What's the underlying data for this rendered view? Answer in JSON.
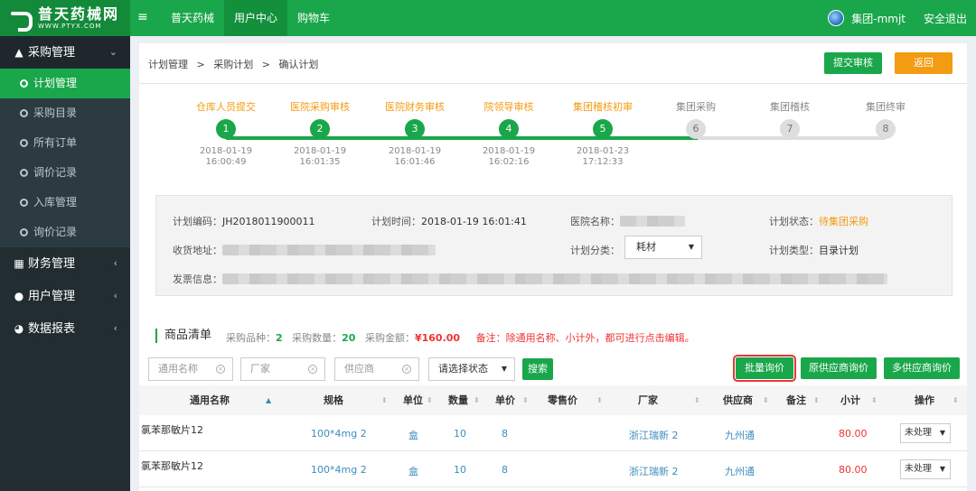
{
  "brand": {
    "name_cn": "普天药械网",
    "name_en": "WWW.PTYX.COM"
  },
  "topnav": [
    {
      "label": "普天药械"
    },
    {
      "label": "用户中心"
    },
    {
      "label": "购物车"
    }
  ],
  "user": {
    "name": "集团-mmjt",
    "logout": "安全退出"
  },
  "sidebar": {
    "groups": [
      {
        "label": "采购管理",
        "icon": "cart-icon"
      },
      {
        "label": "财务管理",
        "icon": "finance-icon"
      },
      {
        "label": "用户管理",
        "icon": "user-icon"
      },
      {
        "label": "数据报表",
        "icon": "chart-icon"
      }
    ],
    "sub_items": [
      {
        "label": "计划管理"
      },
      {
        "label": "采购目录"
      },
      {
        "label": "所有订单"
      },
      {
        "label": "调价记录"
      },
      {
        "label": "入库管理"
      },
      {
        "label": "询价记录"
      }
    ]
  },
  "breadcrumb": {
    "a": "计划管理",
    "sep": ">",
    "b": "采购计划",
    "c": "确认计划"
  },
  "actions": {
    "submit": "提交审核",
    "back": "返回"
  },
  "steps": [
    {
      "num": "1",
      "label": "仓库人员提交",
      "date": "2018-01-19",
      "time": "16:00:49",
      "done": true
    },
    {
      "num": "2",
      "label": "医院采购审核",
      "date": "2018-01-19",
      "time": "16:01:35",
      "done": true
    },
    {
      "num": "3",
      "label": "医院财务审核",
      "date": "2018-01-19",
      "time": "16:01:46",
      "done": true
    },
    {
      "num": "4",
      "label": "院领导审核",
      "date": "2018-01-19",
      "time": "16:02:16",
      "done": true
    },
    {
      "num": "5",
      "label": "集团稽核初审",
      "date": "2018-01-23",
      "time": "17:12:33",
      "done": true
    },
    {
      "num": "6",
      "label": "集团采购",
      "date": "",
      "time": "",
      "done": false
    },
    {
      "num": "7",
      "label": "集团稽核",
      "date": "",
      "time": "",
      "done": false
    },
    {
      "num": "8",
      "label": "集团终审",
      "date": "",
      "time": "",
      "done": false
    }
  ],
  "plan": {
    "code_label": "计划编码：",
    "code": "JH2018011900011",
    "time_label": "计划时间：",
    "time": "2018-01-19 16:01:41",
    "hospital_label": "医院名称：",
    "status_label": "计划状态：",
    "status": "待集团采购",
    "address_label": "收货地址：",
    "category_label": "计划分类：",
    "category": "耗材",
    "type_label": "计划类型：",
    "type": "目录计划",
    "invoice_label": "发票信息："
  },
  "goods": {
    "title": "商品清单",
    "kinds_label": "采购品种：",
    "kinds": "2",
    "qty_label": "采购数量：",
    "qty": "20",
    "amount_label": "采购金额：",
    "amount": "¥160.00",
    "note": "备注：除通用名称、小计外，都可进行点击编辑。"
  },
  "filters": {
    "name_placeholder": "通用名称",
    "maker_placeholder": "厂家",
    "supplier_placeholder": "供应商",
    "status_select": "请选择状态",
    "search": "搜索",
    "batch_inquiry": "批量询价",
    "orig_inquiry": "原供应商询价",
    "multi_inquiry": "多供应商询价"
  },
  "table": {
    "columns": [
      "通用名称",
      "规格",
      "单位",
      "数量",
      "单价",
      "零售价",
      "厂家",
      "供应商",
      "备注",
      "小计",
      "操作"
    ],
    "rows": [
      {
        "name": "氯苯那敏片12",
        "spec": "100*4mg 2",
        "unit": "盒",
        "qty": "10",
        "price": "8",
        "retail": "",
        "maker": "浙江瑞新 2",
        "supplier": "九州通",
        "remark": "",
        "subtotal": "80.00",
        "op": "未处理"
      },
      {
        "name": "氯苯那敏片12",
        "spec": "100*4mg 2",
        "unit": "盒",
        "qty": "10",
        "price": "8",
        "retail": "",
        "maker": "浙江瑞新 2",
        "supplier": "九州通",
        "remark": "",
        "subtotal": "80.00",
        "op": "未处理"
      }
    ]
  },
  "colors": {
    "primary": "#1aa64a",
    "orange": "#f39c12",
    "sidebar": "#222d32",
    "link": "#3c8dbc",
    "danger": "#e33333"
  }
}
